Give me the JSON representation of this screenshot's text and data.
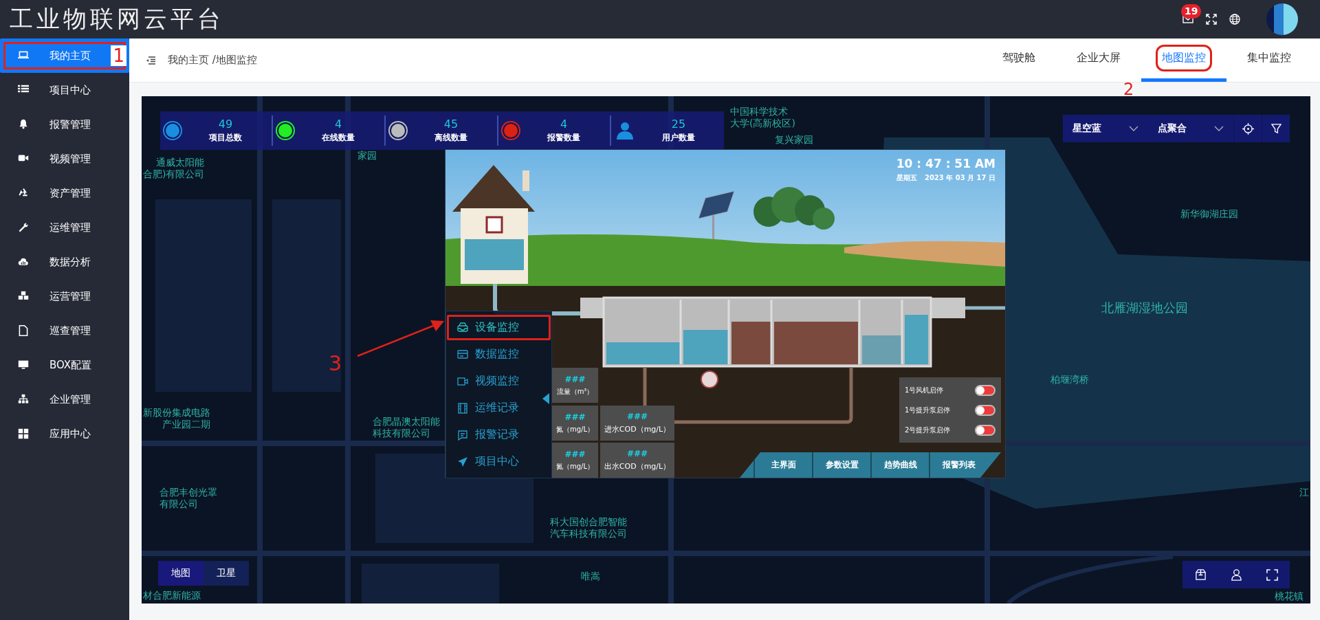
{
  "header": {
    "title": "工业物联网云平台",
    "mail_badge": "19"
  },
  "sidebar": {
    "items": [
      {
        "label": "我的主页",
        "selected": true,
        "highlighted": true,
        "annotation": "1"
      },
      {
        "label": "项目中心",
        "selected": false,
        "highlighted": false
      },
      {
        "label": "报警管理",
        "selected": false,
        "highlighted": false
      },
      {
        "label": "视频管理",
        "selected": false,
        "highlighted": false
      },
      {
        "label": "资产管理",
        "selected": false,
        "highlighted": false
      },
      {
        "label": "运维管理",
        "selected": false,
        "highlighted": false
      },
      {
        "label": "数据分析",
        "selected": false,
        "highlighted": false
      },
      {
        "label": "运营管理",
        "selected": false,
        "highlighted": false
      },
      {
        "label": "巡查管理",
        "selected": false,
        "highlighted": false
      },
      {
        "label": "BOX配置",
        "selected": false,
        "highlighted": false
      },
      {
        "label": "企业管理",
        "selected": false,
        "highlighted": false
      },
      {
        "label": "应用中心",
        "selected": false,
        "highlighted": false
      }
    ]
  },
  "breadcrumb": "我的主页 /地图监控",
  "tabs": [
    {
      "label": "驾驶舱",
      "selected": false,
      "highlighted": false
    },
    {
      "label": "企业大屏",
      "selected": false,
      "highlighted": false
    },
    {
      "label": "地图监控",
      "selected": true,
      "highlighted": true,
      "annotation": "2"
    },
    {
      "label": "集中监控",
      "selected": false,
      "highlighted": false
    }
  ],
  "map": {
    "stats": [
      {
        "kind": "dot",
        "value": "49",
        "label": "项目总数",
        "color": "#1a8fe0"
      },
      {
        "kind": "dot",
        "value": "4",
        "label": "在线数量",
        "color": "#22ee22"
      },
      {
        "kind": "dot",
        "value": "45",
        "label": "离线数量",
        "color": "#bbbbbb"
      },
      {
        "kind": "dot",
        "value": "4",
        "label": "报警数量",
        "color": "#dd2211"
      },
      {
        "kind": "user",
        "value": "25",
        "label": "用户数量"
      }
    ],
    "style_select": "星空蓝",
    "cluster_select": "点聚合",
    "map_types": [
      {
        "label": "地图",
        "selected": true
      },
      {
        "label": "卫星",
        "selected": false
      }
    ],
    "labels": [
      {
        "lines": [
          "通威太阳能",
          "合肥)有限公司"
        ]
      },
      {
        "lines": [
          "中国科学技术",
          "大学(高新校区)"
        ]
      },
      {
        "lines": [
          "家园"
        ]
      },
      {
        "lines": [
          "复兴家园"
        ]
      },
      {
        "lines": [
          "新华御湖庄园"
        ]
      },
      {
        "lines": [
          "北雁湖湿地公园"
        ]
      },
      {
        "lines": [
          "柏堰湾桥"
        ]
      },
      {
        "lines": [
          "新股份集成电路",
          "产业园二期"
        ]
      },
      {
        "lines": [
          "合肥晶澳太阳能",
          "科技有限公司"
        ]
      },
      {
        "lines": [
          "合肥丰创光罩",
          "有限公司"
        ]
      },
      {
        "lines": [
          "科大国创合肥智能",
          "汽车科技有限公司"
        ]
      },
      {
        "lines": [
          "唯嵩"
        ]
      },
      {
        "lines": [
          "材合肥新能源"
        ]
      },
      {
        "lines": [
          "江"
        ]
      },
      {
        "lines": [
          "桃花镇"
        ]
      }
    ],
    "popup": {
      "clock": "10 : 47 : 51 AM",
      "date": "星期五   2023 年 03 月 17 日",
      "menu": [
        {
          "label": "设备监控",
          "selected": true,
          "highlighted": true,
          "annotation": "3"
        },
        {
          "label": "数据监控",
          "selected": false,
          "highlighted": false
        },
        {
          "label": "视频监控",
          "selected": false,
          "highlighted": false
        },
        {
          "label": "运维记录",
          "selected": false,
          "highlighted": false
        },
        {
          "label": "报警记录",
          "selected": false,
          "highlighted": false
        },
        {
          "label": "项目中心",
          "selected": false,
          "highlighted": false
        }
      ],
      "cards": [
        {
          "value": "###",
          "label": "流量（m³）"
        },
        {
          "value": "###",
          "label": "氮（mg/L）"
        },
        {
          "value": "###",
          "label": "进水COD（mg/L）"
        },
        {
          "value": "###",
          "label": "氮（mg/L）"
        },
        {
          "value": "###",
          "label": "出水COD（mg/L）"
        }
      ],
      "switches": [
        {
          "label": "1号风机启停",
          "on": false
        },
        {
          "label": "1号提升泵启停",
          "on": false
        },
        {
          "label": "2号提升泵启停",
          "on": false
        }
      ],
      "tabs": [
        "主界面",
        "参数设置",
        "趋势曲线",
        "报警列表"
      ]
    }
  }
}
